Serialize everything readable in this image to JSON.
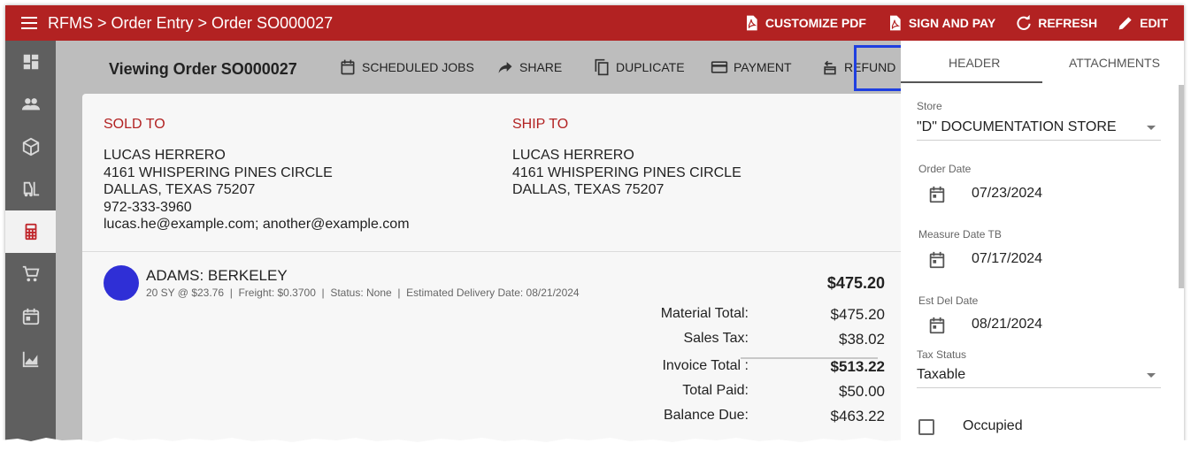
{
  "app": {
    "breadcrumb": "RFMS > Order Entry > Order SO000027"
  },
  "top_actions": {
    "customize_pdf": "CUSTOMIZE PDF",
    "sign_and_pay": "SIGN AND PAY",
    "refresh": "REFRESH",
    "edit": "EDIT"
  },
  "rail": {
    "items": [
      "dashboard-icon",
      "people-icon",
      "package-icon",
      "forklift-icon",
      "calculator-icon",
      "cart-icon",
      "calendar-icon",
      "chart-icon"
    ],
    "active_index": 4
  },
  "toolbar": {
    "title": "Viewing Order SO000027",
    "scheduled_jobs": "SCHEDULED JOBS",
    "share": "SHARE",
    "duplicate": "DUPLICATE",
    "payment": "PAYMENT",
    "refund": "REFUND"
  },
  "sold_to": {
    "label": "SOLD TO",
    "name": "LUCAS HERRERO",
    "street": "4161 WHISPERING PINES CIRCLE",
    "city": "DALLAS, TEXAS 75207",
    "phone": "972-333-3960",
    "email": "lucas.he@example.com; another@example.com"
  },
  "ship_to": {
    "label": "SHIP TO",
    "name": "LUCAS HERRERO",
    "street": "4161 WHISPERING PINES CIRCLE",
    "city": "DALLAS, TEXAS 75207"
  },
  "line_item": {
    "name": "ADAMS: BERKELEY",
    "detail": "20 SY @ $23.76  |  Freight: $0.3700  |  Status: None  |  Estimated Delivery Date: 08/21/2024",
    "price": "$475.20",
    "avatar_color": "#2f2fd6"
  },
  "totals": {
    "material_label": "Material Total:",
    "material": "$475.20",
    "tax_label": "Sales Tax:",
    "tax": "$38.02",
    "invoice_label": "Invoice Total :",
    "invoice": "$513.22",
    "paid_label": "Total Paid:",
    "paid": "$50.00",
    "balance_label": "Balance Due:",
    "balance": "$463.22"
  },
  "panel": {
    "tab_header": "HEADER",
    "tab_attachments": "ATTACHMENTS",
    "store_label": "Store",
    "store_value": "\"D\" DOCUMENTATION STORE",
    "order_date_label": "Order Date",
    "order_date": "07/23/2024",
    "measure_date_label": "Measure Date TB",
    "measure_date": "07/17/2024",
    "est_del_label": "Est Del Date",
    "est_del_date": "08/21/2024",
    "tax_status_label": "Tax Status",
    "tax_status": "Taxable",
    "occupied_label": "Occupied",
    "occupied_checked": false
  },
  "colors": {
    "brand": "#b22222",
    "highlight": "#1f3fe0"
  }
}
